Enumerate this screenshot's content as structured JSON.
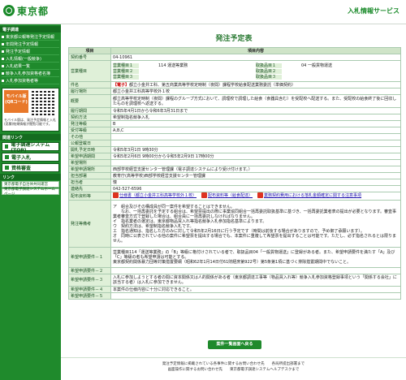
{
  "header": {
    "logo_text": "東京都",
    "service": "入札情報サービス"
  },
  "sidebar": {
    "section_title": "電子調達",
    "links": [
      "東京都公報等発注予定情報",
      "年間発注予定情報",
      "発注予定情報",
      "入札情報(一般競争)",
      "入札結果一覧",
      "競争入札参加資格者名簿",
      "入札参加資格者等"
    ],
    "mobile_badge": "モバイル版\n(QRコード)",
    "mobile_note": "モバイル版は、発注予定情報と入札(見積)結果情報が閲覧可能です。",
    "section2": "関連リンク",
    "buttons": [
      "電子調達システム(TOP)",
      "電子入札",
      "資格審査"
    ],
    "section3": "リンク",
    "foot_links": [
      "東京都電子自治体共同運営",
      "東京都電子調達システムホームページ"
    ]
  },
  "main": {
    "title": "発注予定表",
    "col_item": "項目",
    "col_content": "項目内容",
    "rows": [
      {
        "label": "契約番号",
        "value": "04-10961"
      },
      {
        "label": "営業種目",
        "kind": "cat1"
      },
      {
        "label": "件名",
        "kind": "title"
      },
      {
        "label": "履行場所",
        "value": "都立小金井工科高等学校外１校"
      },
      {
        "label": "概要",
        "value": "都立高等学校定時制（夜間）課程のグループ方式において、調理校で調理した給食（食器具含む）を受配校へ配送する。また、受配校の給食終了後に回収したものを調理校へ返送する。"
      },
      {
        "label": "履行期間",
        "value": "令和5年4月1日から令和6年3月31日まで"
      },
      {
        "label": "契約方法",
        "value": "希望制指名競争入札"
      },
      {
        "label": "発注等級",
        "value": "B"
      },
      {
        "label": "受付等級",
        "value": "A,B,C"
      },
      {
        "label": "その他",
        "value": ""
      },
      {
        "label": "公報登載日",
        "value": ""
      },
      {
        "label": "開札予定日時",
        "value": "令和5年3月1日 9時30分"
      },
      {
        "label": "希望申請期間",
        "value": "令和5年2月6日 9時00分から令和5年2月9日 17時00分"
      },
      {
        "label": "希望場所",
        "value": ""
      },
      {
        "label": "希望申請場所",
        "value": "西部学校経営支援センター管理課（電子調達システムにより受け付けます。）"
      },
      {
        "label": "担当部署",
        "value": "教育庁(高等学校)西部学校経営支援センター管理課"
      },
      {
        "label": "担当者",
        "value": "懐"
      },
      {
        "label": "連絡先",
        "value": "042-527-6596"
      },
      {
        "label": "配布資料等",
        "kind": "pdf"
      },
      {
        "label": "発注等備考",
        "value": "ア　組合及びその構成員が同一案件を希望することはできません。\n　　なお、一括再委託を予定する組合は、希望票提出の際に事業協同組合一括再委託取扱基準に基づき、一括再委託業者表の提出が必要となります。審査事業者審査方式で登録した場合は、組合員に一括再委託しなければなりません。\nイ　指名業者の選定は、東京都物品買入れ等指名競争入札参加指名基準によります。\nウ　契約方法は、希望制指名競争入札です。\nエ　指名通知は、指名した方のみに対して令和5年2月16日に行う予定です（時間は前後する場合がありますので、予め御了承願います）。\nオ　同時に公表されている他の案件に希望票を提出する場合でも、本案件に重複して希望票を提出することは可能です。ただし、必ず指名されるとは限りません。"
      },
      {
        "label": "希望申請要件－１",
        "value": "営業種目114「運送等業務」の「B」等級に格付けされている者で、取扱品目04「一般貨物運送」に登録がある者。また、希望申請要件を満たす「A」及び「C」等級の者も希望申請は可能とする。\n東京都契約関係暴力団等対策措置要綱（昭和62年1月14日付61財経庶第922号）第5条第1項に基づく排除措置期間中でないこと。"
      },
      {
        "label": "希望申請要件－２",
        "value": ""
      },
      {
        "label": "希望申請要件－３",
        "value": "入札に参加しようとする者の間に資本関係又は人的関係がある者（東京都調達工事等（物品買入れ等）競争入札参加資格登録事項という「関係する会社」に該当する者）は入札に参加できません。"
      },
      {
        "label": "希望申請要件－４",
        "value": "本案件の仕様内容に十分に対応できること。"
      },
      {
        "label": "希望申請要件－５",
        "value": ""
      }
    ],
    "cat_rows": [
      {
        "c1": "営業種目１",
        "v1": "114 運送等業務",
        "c2": "取扱品目１",
        "v2": "04 一般貨物運送"
      },
      {
        "c1": "営業種目２",
        "v1": "",
        "c2": "取扱品目２",
        "v2": ""
      },
      {
        "c1": "営業種目３",
        "v1": "",
        "c2": "取扱品目３",
        "v2": ""
      }
    ],
    "title_tag": "【電子】",
    "title_text": "都立小金井工科、第五商業高等学校定時制（夜間）課程学校給食配送業務委託（単価契約）",
    "pdfs": [
      "仕様書（都立小金井工科高等学校外１校）",
      "配布資料等（給食配達）",
      "業務契約費用における落札金額確定に関する注意事項"
    ],
    "back": "案件一覧画面へ戻る"
  },
  "footer": {
    "line1": "発注予定情報に掲載されている各事件に関するお問い合わせ先　　各局所提出部署まで",
    "line2": "画面操作に関するお問い合わせ先　　東京都電子調達システムヘルプデスクまで"
  }
}
